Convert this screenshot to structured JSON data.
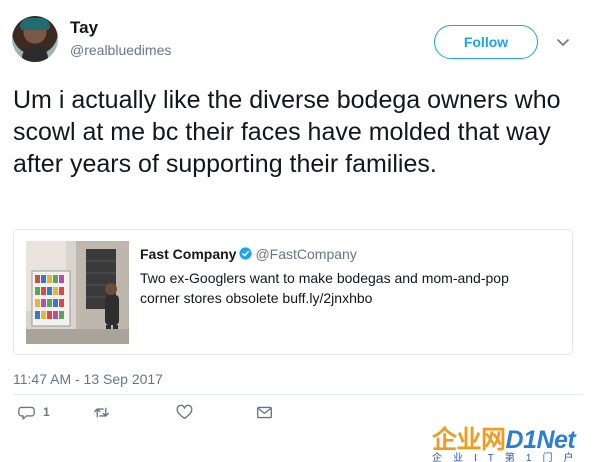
{
  "user": {
    "name": "Tay",
    "handle": "@realbluedimes"
  },
  "follow_label": "Follow",
  "tweet": {
    "text": "Um i actually like the diverse bodega owners who scowl at me bc their faces have molded that way after years of supporting their families."
  },
  "quote": {
    "author": "Fast Company",
    "handle": "@FastCompany",
    "text": "Two ex-Googlers want to make bodegas and mom-and-pop corner stores obsolete buff.ly/2jnxhbo",
    "verified": true
  },
  "timestamp": "11:47 AM - 13 Sep 2017",
  "actions": {
    "reply_count": "1"
  },
  "watermark": {
    "cn": "企业网",
    "en": "D1Net",
    "sub": "企业IT第1门户"
  },
  "colors": {
    "accent": "#1da1f2",
    "muted": "#657786",
    "text": "#14171a",
    "verified": "#1da1f2"
  }
}
